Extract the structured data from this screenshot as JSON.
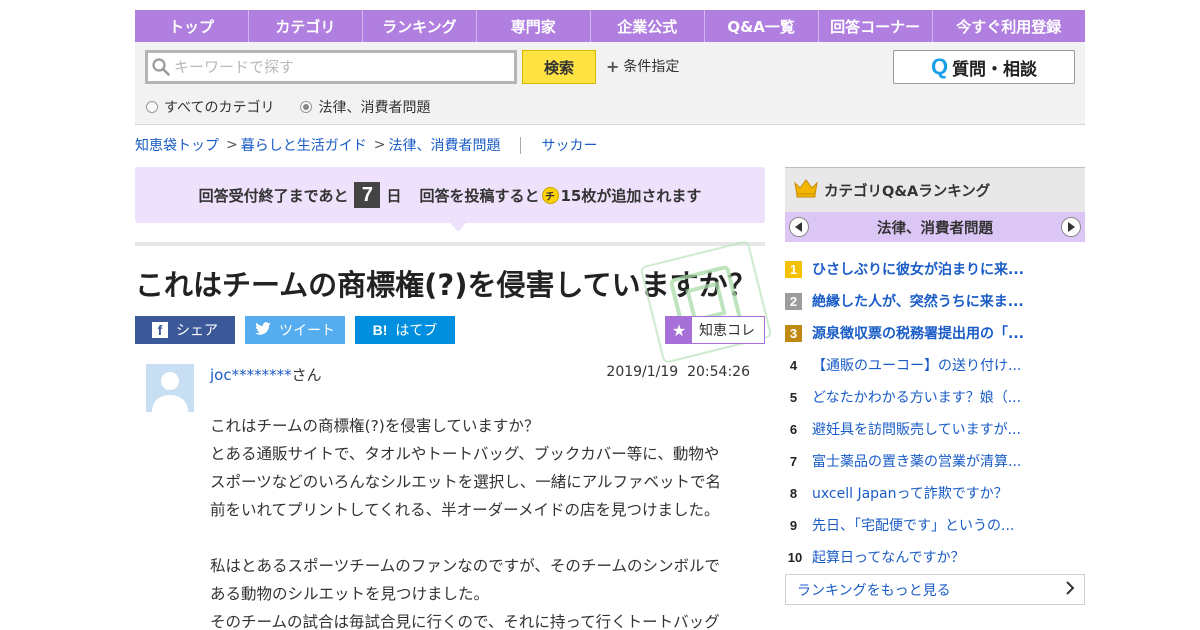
{
  "nav": {
    "items": [
      "トップ",
      "カテゴリ",
      "ランキング",
      "専門家",
      "企業公式",
      "Q&A一覧",
      "回答コーナー",
      "今すぐ利用登録"
    ]
  },
  "search": {
    "placeholder": "キーワードで探す",
    "button": "検索",
    "conditions": "条件指定",
    "ask_button": "質問・相談",
    "ask_icon": "Q",
    "radio_all": "すべてのカテゴリ",
    "radio_current": "法律、消費者問題",
    "selected": "法律、消費者問題"
  },
  "breadcrumb": {
    "items": [
      "知恵袋トップ",
      "暮らしと生活ガイド",
      "法律、消費者問題"
    ],
    "sep": ">",
    "related": "サッカー"
  },
  "notice": {
    "prefix": "回答受付終了まであと",
    "days": "7",
    "days_unit": "日",
    "reward_prefix": "回答を投稿すると",
    "coin_icon": "チ",
    "reward_suffix": "15枚が追加されます"
  },
  "question": {
    "title": "これはチームの商標権(?)を侵害していますか？",
    "user_id": "joc********",
    "user_suffix": "さん",
    "date": "2019/1/19",
    "time": "20:54:26",
    "body": [
      "これはチームの商標権(?)を侵害していますか？",
      "とある通販サイトで、タオルやトートバッグ、ブックカバー等に、動物や",
      "スポーツなどのいろんなシルエットを選択し、一緒にアルファベットで名",
      "前をいれてプリントしてくれる、半オーダーメイドの店を見つけました。",
      "",
      "私はとあるスポーツチームのファンなのですが、そのチームのシンボルで",
      "ある動物のシルエットを見つけました。",
      "そのチームの試合は毎試合見に行くので、それに持って行くトートバッグ"
    ]
  },
  "share": {
    "facebook": "シェア",
    "facebook_icon": "f",
    "twitter": "ツイート",
    "twitter_icon": "🐦",
    "hatena": "はてブ",
    "hatena_icon": "B!",
    "chie_colle": "知恵コレ",
    "star_icon": "★"
  },
  "ranking": {
    "title": "カテゴリQ&Aランキング",
    "category": "法律、消費者問題",
    "items": [
      {
        "num": "1",
        "text": "ひさしぶりに彼女が泊まりに来..."
      },
      {
        "num": "2",
        "text": "絶縁した人が、突然うちに来ま..."
      },
      {
        "num": "3",
        "text": "源泉徴収票の税務署提出用の「..."
      },
      {
        "num": "4",
        "text": "【通販のユーコー】の送り付け..."
      },
      {
        "num": "5",
        "text": "どなたかわかる方います？娘（..."
      },
      {
        "num": "6",
        "text": "避妊具を訪問販売していますが..."
      },
      {
        "num": "7",
        "text": "富士薬品の置き薬の営業が清算..."
      },
      {
        "num": "8",
        "text": "uxcell Japanって詐欺ですか？"
      },
      {
        "num": "9",
        "text": "先日、「宅配便です」というの..."
      },
      {
        "num": "10",
        "text": "起算日ってなんですか？"
      }
    ],
    "more": "ランキングをもっと見る"
  },
  "colors": {
    "nav": "#b07fe0",
    "notice": "#ede1fb",
    "link": "#1a5cc7",
    "search_button": "#ffe342",
    "category_bar": "#dcc6f6"
  }
}
